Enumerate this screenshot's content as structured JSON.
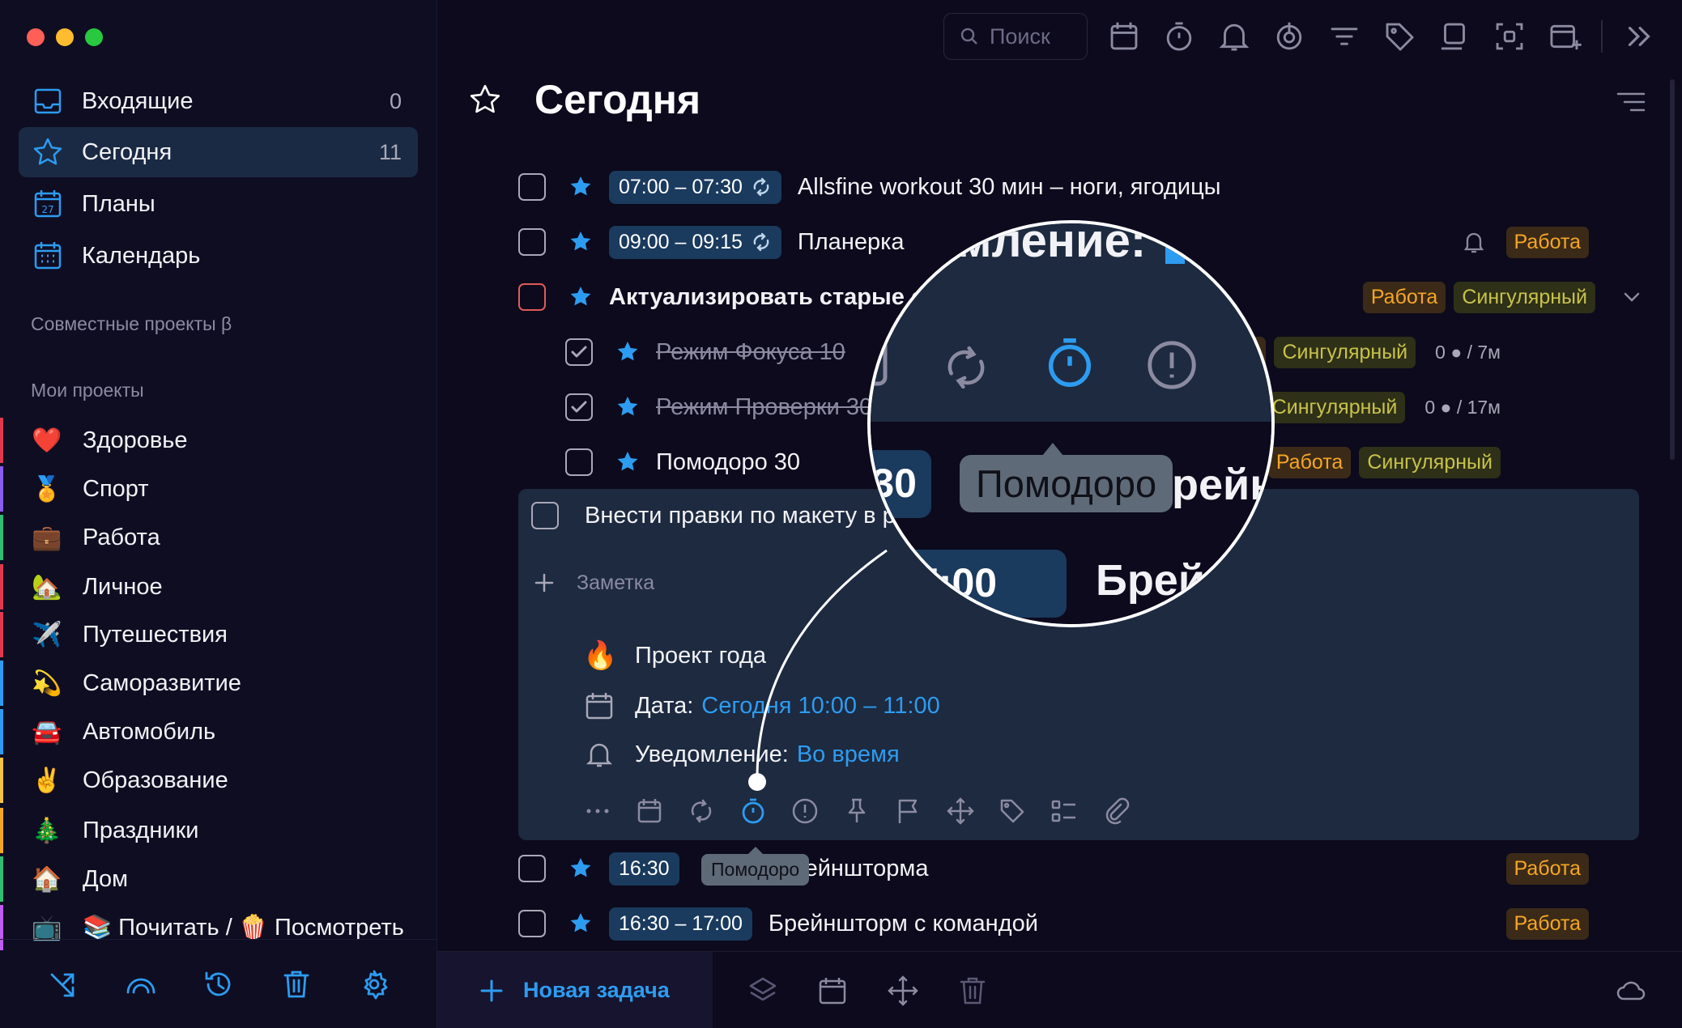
{
  "sidebar": {
    "nav": [
      {
        "label": "Входящие",
        "count": "0",
        "icon": "inbox-icon"
      },
      {
        "label": "Сегодня",
        "count": "11",
        "icon": "star-icon"
      },
      {
        "label": "Планы",
        "count": "",
        "icon": "plans-calendar-icon"
      },
      {
        "label": "Календарь",
        "count": "",
        "icon": "calendar-icon"
      }
    ],
    "shared_title": "Совместные проекты β",
    "projects_title": "Мои проекты",
    "projects": [
      {
        "emoji": "❤️",
        "label": "Здоровье",
        "color": "#e0394d"
      },
      {
        "emoji": "🏅",
        "label": "Спорт",
        "color": "#8a5cf0"
      },
      {
        "emoji": "💼",
        "label": "Работа",
        "color": "#2fbf71"
      },
      {
        "emoji": "🏡",
        "label": "Личное",
        "color": "#e0394d"
      },
      {
        "emoji": "✈️",
        "label": "Путешествия",
        "color": "#e0394d"
      },
      {
        "emoji": "💫",
        "label": "Саморазвитие",
        "color": "#2d9cf0"
      },
      {
        "emoji": "🚘",
        "label": "Автомобиль",
        "color": "#2d9cf0"
      },
      {
        "emoji": "✌️",
        "label": "Образование",
        "color": "#f5c242"
      },
      {
        "emoji": "🎄",
        "label": "Праздники",
        "color": "#f5a623"
      },
      {
        "emoji": "🏠",
        "label": "Дом",
        "color": "#2fbf71"
      },
      {
        "emoji": "📺",
        "label": "📚 Почитать / 🍿 Посмотреть",
        "color": "#c05cf0"
      }
    ],
    "bottom_icons": [
      "shuffle-icon",
      "rainbow-icon",
      "history-icon",
      "trash-icon",
      "gear-icon"
    ]
  },
  "toolbar": {
    "search_placeholder": "Поиск",
    "icons": [
      "calendar-icon",
      "timer-icon",
      "bell-icon",
      "power-icon",
      "filter-icon",
      "tag-icon",
      "copy-icon",
      "focus-icon",
      "add-window-icon",
      "chevrons-right-icon"
    ]
  },
  "page": {
    "title": "Сегодня"
  },
  "tasks": [
    {
      "time": "07:00 – 07:30",
      "repeat": true,
      "title": "Allsfine workout 30 мин – ноги, ягодицы",
      "starred": true
    },
    {
      "time": "09:00 – 09:15",
      "repeat": true,
      "title": "Планерка",
      "starred": true,
      "bell": true,
      "tags": [
        "Работа"
      ]
    },
    {
      "title": "Актуализировать старые с",
      "starred": true,
      "bold": true,
      "tags": [
        "Работа",
        "Сингулярный"
      ],
      "expand": true
    },
    {
      "title": "Режим Фокуса 10",
      "starred": true,
      "done": true,
      "sub": true,
      "tags": [
        "Работа",
        "Сингулярный"
      ],
      "meta": "0 ● / 7м"
    },
    {
      "title": "Режим Проверки 30",
      "starred": true,
      "done": true,
      "sub": true,
      "tags": [
        "Работа",
        "Сингулярный"
      ],
      "meta": "0 ● / 17м"
    },
    {
      "title": "Помодоро 30",
      "starred": true,
      "sub": true,
      "tags": [
        "Работа",
        "Сингулярный"
      ]
    }
  ],
  "expanded": {
    "title": "Внести правки по макету в р",
    "note_placeholder": "Заметка",
    "project_emoji": "🔥",
    "project": "Проект года",
    "date_label": "Дата:",
    "date_value": "Сегодня 10:00 – 11:00",
    "notify_label": "Уведомление:",
    "notify_value": "Во время",
    "actions": [
      "more-icon",
      "calendar-icon",
      "repeat-icon",
      "timer-icon",
      "alert-icon",
      "pin-icon",
      "flag-icon",
      "move-icon",
      "tag-icon",
      "checklist-icon",
      "paperclip-icon"
    ]
  },
  "tasks_after": [
    {
      "time": "16:30",
      "title": "ейншторма",
      "tag": "Работа"
    },
    {
      "time": "16:30 – 17:00",
      "title": "Брейншторм с командой",
      "tag": "Работа"
    }
  ],
  "tooltip": "Помодоро",
  "magnifier": {
    "top_text": "омление: ",
    "tooltip": "Помодоро",
    "left_time": "30",
    "right_text": "рейн",
    "bottom_time": "7:00",
    "bottom_text": "Брей"
  },
  "bottom_bar": {
    "new_task": "Новая задача"
  },
  "colors": {
    "accent": "#2d9cf0",
    "work_tag": "#f5a623",
    "singular_tag": "#c8c24a",
    "background": "#0c0a1c"
  }
}
